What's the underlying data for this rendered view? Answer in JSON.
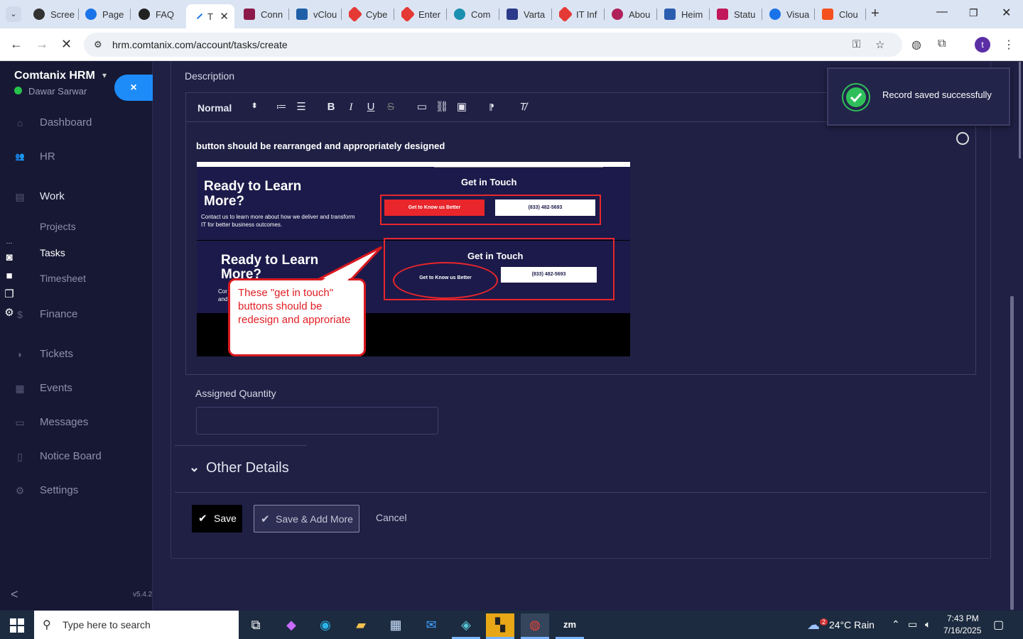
{
  "browser": {
    "tabs": [
      {
        "label": "Scree",
        "color": "#333333"
      },
      {
        "label": "Page",
        "color": "#1a73e8"
      },
      {
        "label": "FAQ",
        "color": "#222222"
      },
      {
        "label": "T",
        "color": "#1a73e8",
        "active": true
      },
      {
        "label": "Conn",
        "color": "#8b1a4a"
      },
      {
        "label": "vClou",
        "color": "#1f5fa8"
      },
      {
        "label": "Cybe",
        "color": "#e53935"
      },
      {
        "label": "Enter",
        "color": "#e53935"
      },
      {
        "label": "Com",
        "color": "#1a8fb0"
      },
      {
        "label": "Varta",
        "color": "#2b3a8a"
      },
      {
        "label": "IT Inf",
        "color": "#e53935"
      },
      {
        "label": "Abou",
        "color": "#b0205a"
      },
      {
        "label": "Heim",
        "color": "#2a5db0"
      },
      {
        "label": "Statu",
        "color": "#c2185b"
      },
      {
        "label": "Visua",
        "color": "#1a73e8"
      },
      {
        "label": "Clou",
        "color": "#f4511e"
      }
    ],
    "close_tab": "✕",
    "new_tab": "+",
    "url": "hrm.comtanix.com/account/tasks/create",
    "profile_initial": "t"
  },
  "sidebar": {
    "brand": "Comtanix HRM",
    "user": "Dawar Sarwar",
    "close_label": "×",
    "items": [
      {
        "label": "Dashboard",
        "icon": "⌂"
      },
      {
        "label": "HR",
        "icon": "👥"
      },
      {
        "label": "Work",
        "icon": "▤"
      },
      {
        "label": "Projects"
      },
      {
        "label": "Tasks"
      },
      {
        "label": "Timesheet"
      },
      {
        "label": "Finance",
        "icon": "$"
      },
      {
        "label": "Tickets",
        "icon": "◗"
      },
      {
        "label": "Events",
        "icon": "▦"
      },
      {
        "label": "Messages",
        "icon": "▭"
      },
      {
        "label": "Notice Board",
        "icon": "▯"
      },
      {
        "label": "Settings",
        "icon": "⚙"
      }
    ],
    "collapse": "<",
    "version": "v5.4.2"
  },
  "form": {
    "description_label": "Description",
    "format_select": "Normal",
    "editor_text": "button should be rearranged and appropriately designed",
    "screenshot": {
      "heading": "Ready to Learn More?",
      "subtext": "Contact us to learn more about how we deliver and transform IT for better business outcomes.",
      "heading2_line1": "Ready to Learn",
      "heading2_line2": "More?",
      "subtext2_a": "Cor",
      "subtext2_b": "and",
      "get_in_touch": "Get in Touch",
      "cta_primary": "Get to Know us Better",
      "cta_phone": "(833) 482-5693",
      "callout": "These \"get in touch\" buttons should be redesign and approriate"
    },
    "assigned_quantity_label": "Assigned Quantity",
    "assigned_quantity_value": "",
    "other_details": "Other Details",
    "save": "Save",
    "save_add_more": "Save & Add More",
    "cancel": "Cancel"
  },
  "toast": {
    "message": "Record saved successfully"
  },
  "taskbar": {
    "search_placeholder": "Type here to search",
    "weather": "24°C  Rain",
    "weather_badge": "2",
    "time": "7:43 PM",
    "date": "7/16/2025"
  }
}
